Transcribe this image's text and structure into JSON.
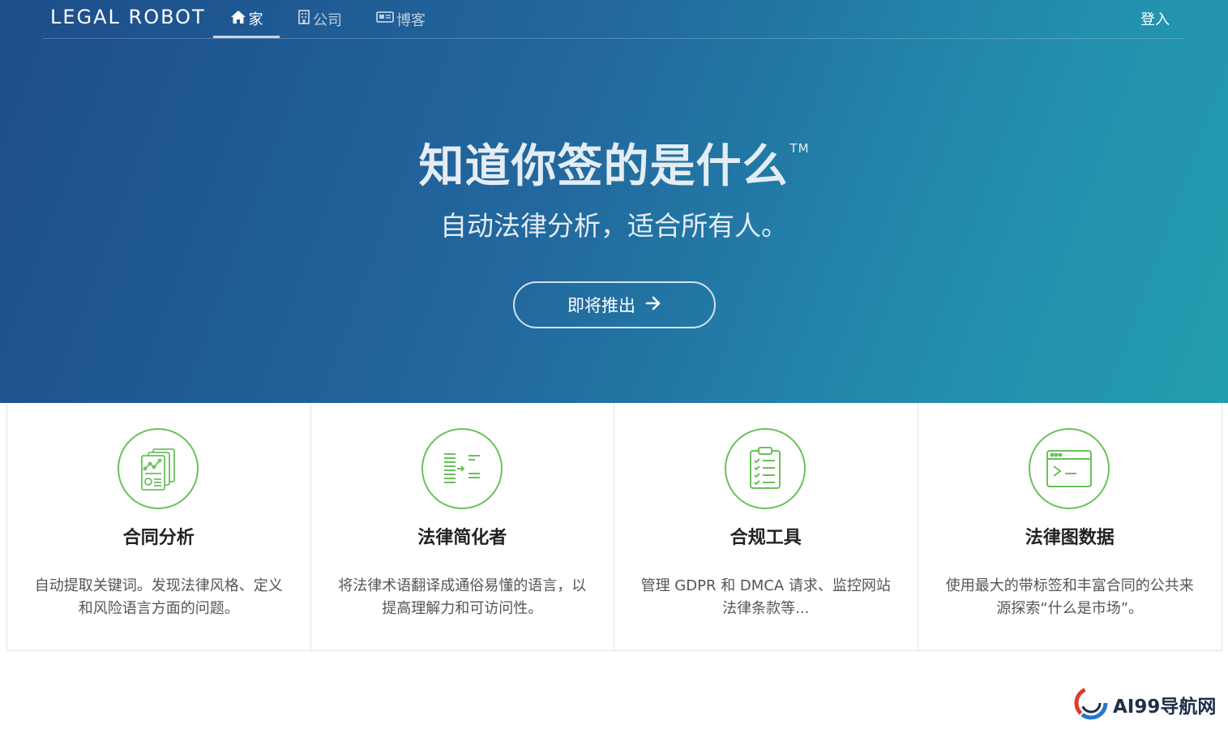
{
  "navbar": {
    "brand": "LEGAL ROBOT",
    "items": [
      {
        "label": "家",
        "icon": "home-icon",
        "active": true
      },
      {
        "label": "公司",
        "icon": "building-icon",
        "active": false
      },
      {
        "label": "博客",
        "icon": "newspaper-icon",
        "active": false
      }
    ],
    "login_label": "登入"
  },
  "hero": {
    "headline": "知道你签的是什么",
    "trademark": "TM",
    "subheadline": "自动法律分析，适合所有人。",
    "cta_label": "即将推出",
    "cta_icon": "arrow-right-icon"
  },
  "features": [
    {
      "icon": "contract-analysis-icon",
      "title": "合同分析",
      "description": "自动提取关键词。发现法律风格、定义和风险语言方面的问题。"
    },
    {
      "icon": "legal-simplifier-icon",
      "title": "法律简化者",
      "description": "将法律术语翻译成通俗易懂的语言，以提高理解力和可访问性。"
    },
    {
      "icon": "compliance-checklist-icon",
      "title": "合规工具",
      "description": "管理 GDPR 和 DMCA 请求、监控网站法律条款等..."
    },
    {
      "icon": "terminal-window-icon",
      "title": "法律图数据",
      "description": "使用最大的带标签和丰富合同的公共来源探索“什么是市场”。"
    }
  ],
  "watermark": {
    "text": "AI99导航网",
    "icon": "ai99-logo-icon"
  },
  "colors": {
    "hero_gradient_start": "#1d4d8a",
    "hero_gradient_end": "#239cae",
    "icon_green": "#6cbf5d",
    "text_dark": "#222222",
    "text_muted": "#555555"
  }
}
